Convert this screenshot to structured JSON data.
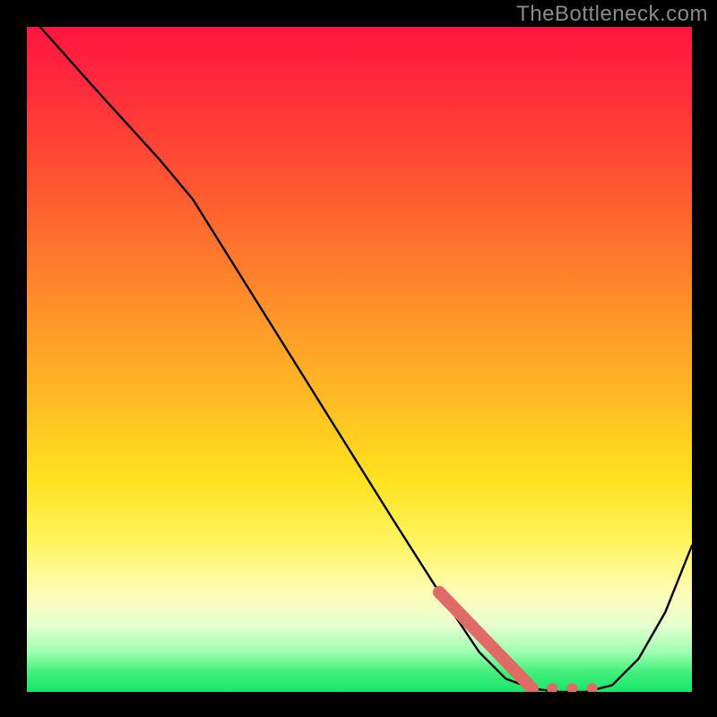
{
  "watermark": "TheBottleneck.com",
  "chart_data": {
    "type": "line",
    "title": "",
    "xlabel": "",
    "ylabel": "",
    "xlim": [
      0,
      100
    ],
    "ylim": [
      0,
      100
    ],
    "grid": false,
    "series": [
      {
        "name": "curve",
        "color": "#000000",
        "x": [
          2,
          10,
          20,
          25,
          35,
          45,
          55,
          62,
          68,
          72,
          76,
          80,
          84,
          88,
          92,
          96,
          100
        ],
        "y": [
          100,
          91,
          80,
          74,
          58,
          42,
          26,
          15,
          6,
          2,
          0.5,
          0,
          0,
          1,
          5,
          12,
          22
        ]
      }
    ],
    "highlight": {
      "name": "highlight-band",
      "color": "#e06a66",
      "segment": {
        "x": [
          62,
          76
        ],
        "y": [
          15,
          0.5
        ]
      },
      "dots": [
        {
          "x": 79,
          "y": 0.5
        },
        {
          "x": 82,
          "y": 0.5
        },
        {
          "x": 85,
          "y": 0.5
        }
      ]
    }
  }
}
